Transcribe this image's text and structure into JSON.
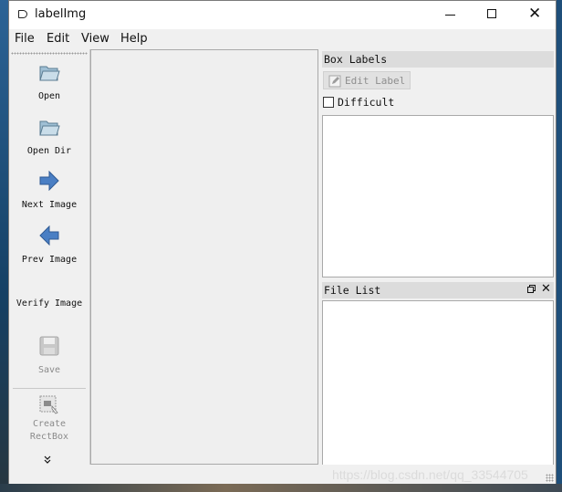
{
  "window": {
    "title": "labelImg",
    "controls": {
      "minimize_icon": "minimize-icon",
      "maximize_icon": "maximize-icon",
      "close_icon": "close-icon",
      "close_glyph": "✕"
    }
  },
  "menu": [
    "File",
    "Edit",
    "View",
    "Help"
  ],
  "toolbar": {
    "tools": [
      {
        "label": "Open",
        "icon": "folder-open-icon",
        "enabled": true
      },
      {
        "label": "Open Dir",
        "icon": "folder-open-icon",
        "enabled": true
      },
      {
        "label": "Next Image",
        "icon": "arrow-right-icon",
        "enabled": true
      },
      {
        "label": "Prev Image",
        "icon": "arrow-left-icon",
        "enabled": true
      },
      {
        "label": "Verify Image",
        "icon": "",
        "enabled": true
      },
      {
        "label": "Save",
        "icon": "floppy-icon",
        "enabled": false
      },
      {
        "label": "Create\nRectBox",
        "icon": "create-rectbox-icon",
        "enabled": false
      }
    ],
    "more_glyph": "»"
  },
  "box_labels": {
    "title": "Box Labels",
    "edit_label_button": "Edit Label",
    "difficult_label": "Difficult",
    "difficult_checked": false
  },
  "file_list": {
    "title": "File List",
    "float_icon": "dock-float-icon",
    "close_glyph": "✕"
  },
  "watermark": "https://blog.csdn.net/qq_33544705",
  "colors": {
    "window_bg": "#f0f0f0",
    "dock_title_bg": "#dcdcdc",
    "arrow_blue": "#4a7fc4",
    "disabled_text": "#8a8a8a"
  }
}
